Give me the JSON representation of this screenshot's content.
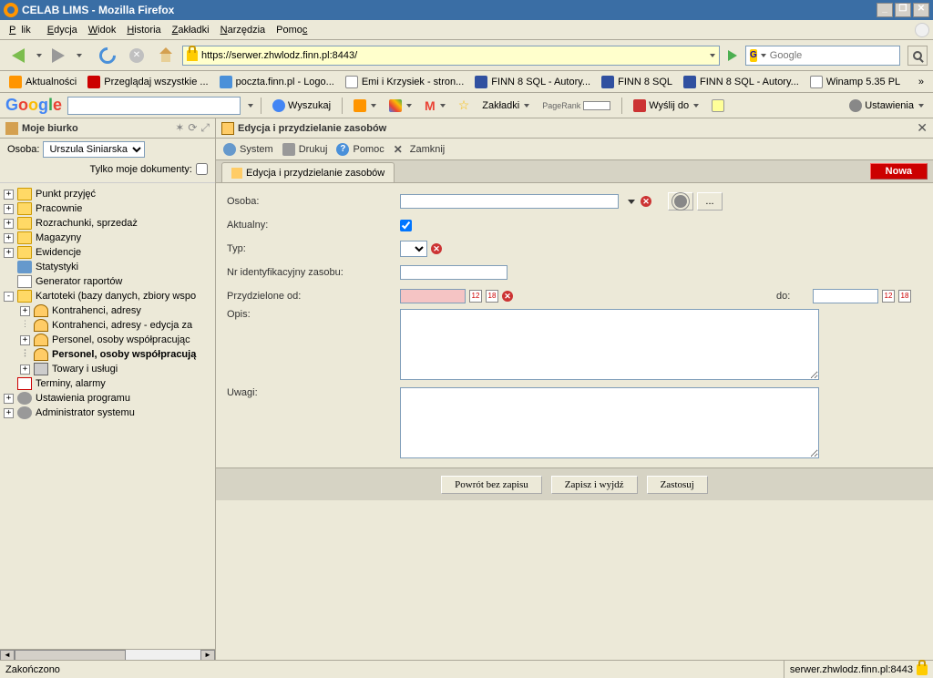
{
  "window": {
    "title": "CELAB LIMS - Mozilla Firefox"
  },
  "menu": {
    "file": "Plik",
    "edit": "Edycja",
    "view": "Widok",
    "history": "Historia",
    "bookmarks": "Zakładki",
    "tools": "Narzędzia",
    "help": "Pomoc"
  },
  "url": "https://serwer.zhwlodz.finn.pl:8443/",
  "search_placeholder": "Google",
  "bookmarks": {
    "b1": "Aktualności",
    "b2": "Przeglądaj wszystkie ...",
    "b3": "poczta.finn.pl - Logo...",
    "b4": "Emi i Krzysiek - stron...",
    "b5": "FINN 8 SQL - Autory...",
    "b6": "FINN 8 SQL",
    "b7": "FINN 8 SQL - Autory...",
    "b8": "Winamp 5.35 PL"
  },
  "gbar": {
    "search_btn": "Wyszukaj",
    "bookmarks": "Zakładki",
    "pagerank": "PageRank",
    "send": "Wyślij do",
    "settings": "Ustawienia"
  },
  "sidebar": {
    "title": "Moje biurko",
    "osoba_label": "Osoba:",
    "osoba_value": "Urszula Siniarska",
    "only_mine": "Tylko moje dokumenty:",
    "items": [
      "Punkt przyjęć",
      "Pracownie",
      "Rozrachunki, sprzedaż",
      "Magazyny",
      "Ewidencje",
      "Statystyki",
      "Generator raportów",
      "Kartoteki (bazy danych, zbiory wspo"
    ],
    "sub": [
      "Kontrahenci, adresy",
      "Kontrahenci, adresy - edycja za",
      "Personel, osoby współpracując",
      "Personel, osoby współpracują",
      "Towary i usługi"
    ],
    "items2": [
      "Terminy, alarmy",
      "Ustawienia programu",
      "Administrator systemu"
    ]
  },
  "content": {
    "title": "Edycja i przydzielanie zasobów",
    "toolbar": {
      "system": "System",
      "print": "Drukuj",
      "help": "Pomoc",
      "close": "Zamknij"
    },
    "tab": "Edycja i przydzielanie zasobów",
    "badge": "Nowa",
    "form": {
      "osoba": "Osoba:",
      "aktualny": "Aktualny:",
      "typ": "Typ:",
      "nr_id": "Nr identyfikacyjny zasobu:",
      "przydz_od": "Przydzielone od:",
      "do": "do:",
      "opis": "Opis:",
      "uwagi": "Uwagi:"
    },
    "buttons": {
      "cancel": "Powrót bez zapisu",
      "save": "Zapisz i wyjdź",
      "apply": "Zastosuj"
    }
  },
  "status": {
    "left": "Zakończono",
    "right": "serwer.zhwlodz.finn.pl:8443"
  }
}
